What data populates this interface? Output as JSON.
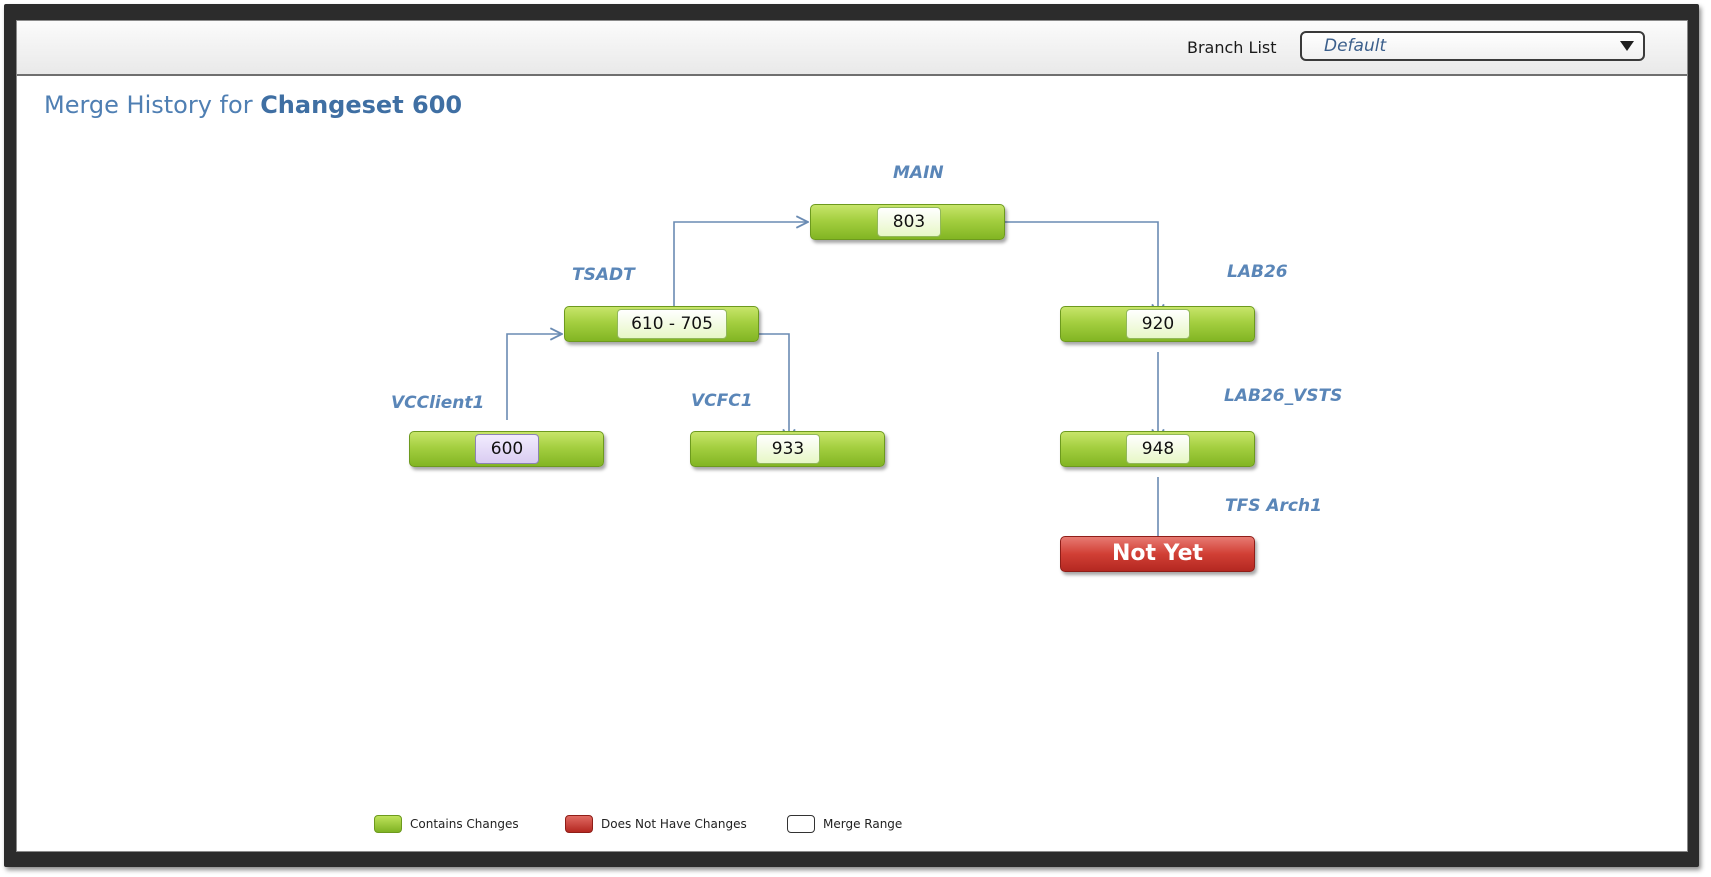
{
  "toolbar": {
    "branch_list_label": "Branch List",
    "branch_list_value": "Default"
  },
  "title": {
    "prefix": "Merge History for ",
    "emphasis": "Changeset 600"
  },
  "branches": {
    "main": {
      "name": "MAIN",
      "changeset": "803"
    },
    "tsadt": {
      "name": "TSADT",
      "changeset": "610 - 705"
    },
    "lab26": {
      "name": "LAB26",
      "changeset": "920"
    },
    "vcclient1": {
      "name": "VCClient1",
      "changeset": "600"
    },
    "vcfc1": {
      "name": "VCFC1",
      "changeset": "933"
    },
    "lab26_vsts": {
      "name": "LAB26_VSTS",
      "changeset": "948"
    },
    "tfs_arch1": {
      "name": "TFS Arch1",
      "status": "Not Yet"
    }
  },
  "legend": {
    "contains": "Contains Changes",
    "not_have": "Does Not Have Changes",
    "merge_range": "Merge Range"
  },
  "colors": {
    "contains_changes": "#9bc93a",
    "does_not_have_changes": "#cc3a31",
    "merge_range_chip": "#d9ccf1",
    "connector": "#6a8bb3",
    "branch_name": "#5a86b8"
  }
}
